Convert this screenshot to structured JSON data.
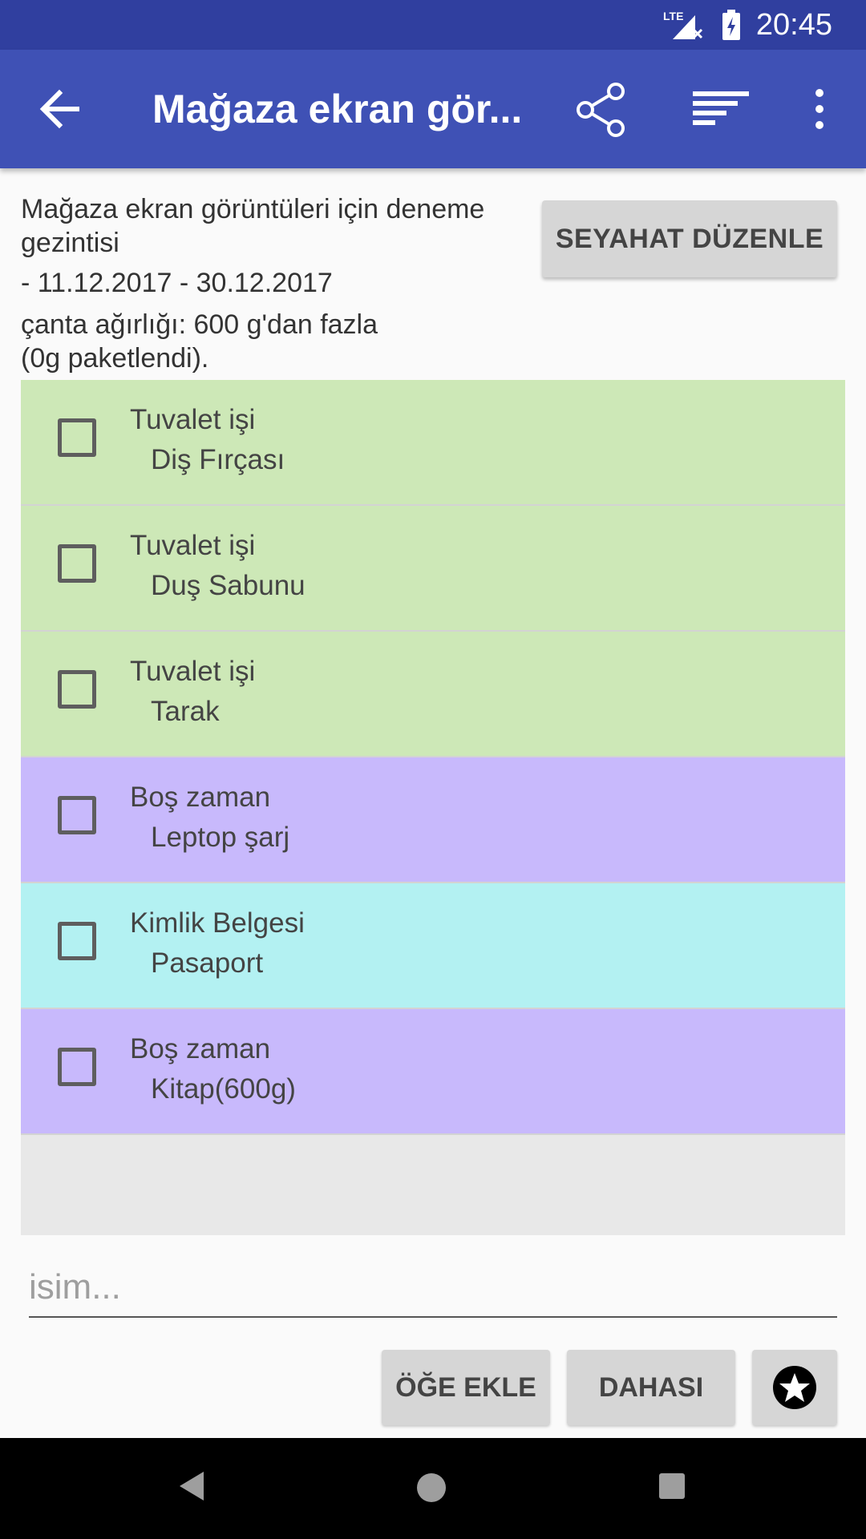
{
  "status_bar": {
    "network": "LTE",
    "time": "20:45"
  },
  "app_bar": {
    "title": "Mağaza ekran gör...",
    "back_icon": "arrow-back-icon",
    "share_icon": "share-icon",
    "sort_icon": "sort-icon",
    "more_icon": "more-vert-icon"
  },
  "trip": {
    "name": "Mağaza ekran görüntüleri için deneme gezintisi",
    "dates": "- 11.12.2017 - 30.12.2017",
    "weight_line1": "çanta ağırlığı: 600 g'dan fazla",
    "weight_line2": "(0g paketlendi).",
    "edit_button": "SEYAHAT DÜZENLE"
  },
  "items": [
    {
      "category": "Tuvalet işi",
      "name": "Diş Fırçası",
      "color": "#cde8b7",
      "checked": false
    },
    {
      "category": "Tuvalet işi",
      "name": "Duş Sabunu",
      "color": "#cde8b7",
      "checked": false
    },
    {
      "category": "Tuvalet işi",
      "name": "Tarak",
      "color": "#cde8b7",
      "checked": false
    },
    {
      "category": "Boş zaman",
      "name": "Leptop şarj",
      "color": "#c8b9fc",
      "checked": false
    },
    {
      "category": "Kimlik Belgesi",
      "name": "Pasaport",
      "color": "#b3f1f2",
      "checked": false
    },
    {
      "category": "Boş zaman",
      "name": "Kitap(600g)",
      "color": "#c8b9fc",
      "checked": false
    }
  ],
  "input": {
    "placeholder": "isim...",
    "value": ""
  },
  "actions": {
    "add_item": "ÖĞE EKLE",
    "more": "DAHASI",
    "favorite_icon": "star-circle-icon"
  },
  "nav_bar": {
    "back_icon": "nav-back-icon",
    "home_icon": "nav-home-icon",
    "recents_icon": "nav-recents-icon"
  }
}
